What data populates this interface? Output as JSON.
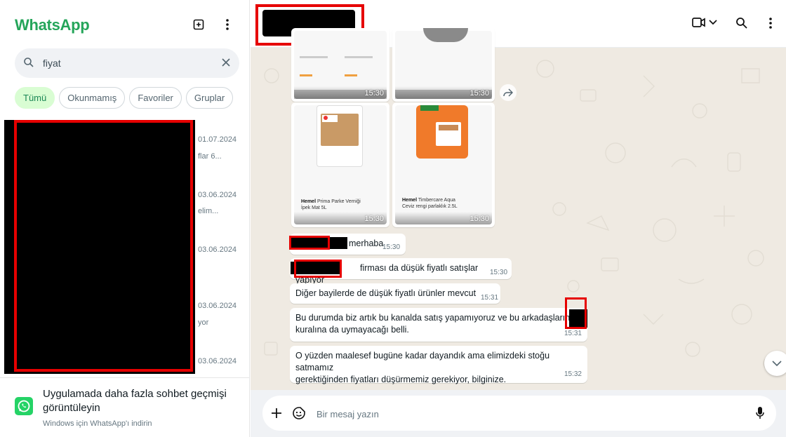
{
  "app": {
    "brand": "WhatsApp"
  },
  "search": {
    "value": "fiyat"
  },
  "filters": [
    "Tümü",
    "Okunmamış",
    "Favoriler",
    "Gruplar"
  ],
  "chat_list": [
    {
      "date": "01.07.2024",
      "preview": "flar  6..."
    },
    {
      "date": "03.06.2024",
      "preview": "elim..."
    },
    {
      "date": "03.06.2024",
      "preview": ""
    },
    {
      "date": "03.06.2024",
      "preview": "yor"
    },
    {
      "date": "03.06.2024",
      "preview": ""
    }
  ],
  "promo": {
    "title": "Uygulamada daha fazla sohbet geçmişi görüntüleyin",
    "subtitle": "Windows için WhatsApp'ı indirin"
  },
  "images": [
    {
      "time": "15:30"
    },
    {
      "time": "15:30"
    },
    {
      "time": "15:30",
      "caption_brand": "Hemel",
      "caption_text": "Prima Parke Verniği",
      "caption_sub": "İpek Mat 5L"
    },
    {
      "time": "15:30",
      "caption_brand": "Hemel",
      "caption_text": "Timbercare Aqua",
      "caption_sub": "Ceviz rengi parlaklık 2.5L"
    }
  ],
  "messages": [
    {
      "text": "merhaba",
      "time": "15:30"
    },
    {
      "text": "firması da düşük fiyatlı satışlar yapıyor",
      "time": "15:30"
    },
    {
      "text": "Diğer bayilerde de düşük fiyatlı ürünler mevcut",
      "time": "15:31"
    },
    {
      "text": "Bu durumda biz artık bu kanalda satış yapamıyoruz ve bu arkadaşların",
      "text2": "kuralına da uymayacağı belli.",
      "time": "15:31"
    },
    {
      "text": "O yüzden maalesef bugüne kadar dayandık ama elimizdeki stoğu satmamız",
      "text2": "gerektiğinden fiyatları düşürmemiz gerekiyor, bilginize.",
      "time": "15:32"
    }
  ],
  "composer": {
    "placeholder": "Bir mesaj yazın"
  },
  "colors": {
    "brand_green": "#25a55a",
    "chat_bg": "#efeae2",
    "redaction_border": "#e60000"
  }
}
